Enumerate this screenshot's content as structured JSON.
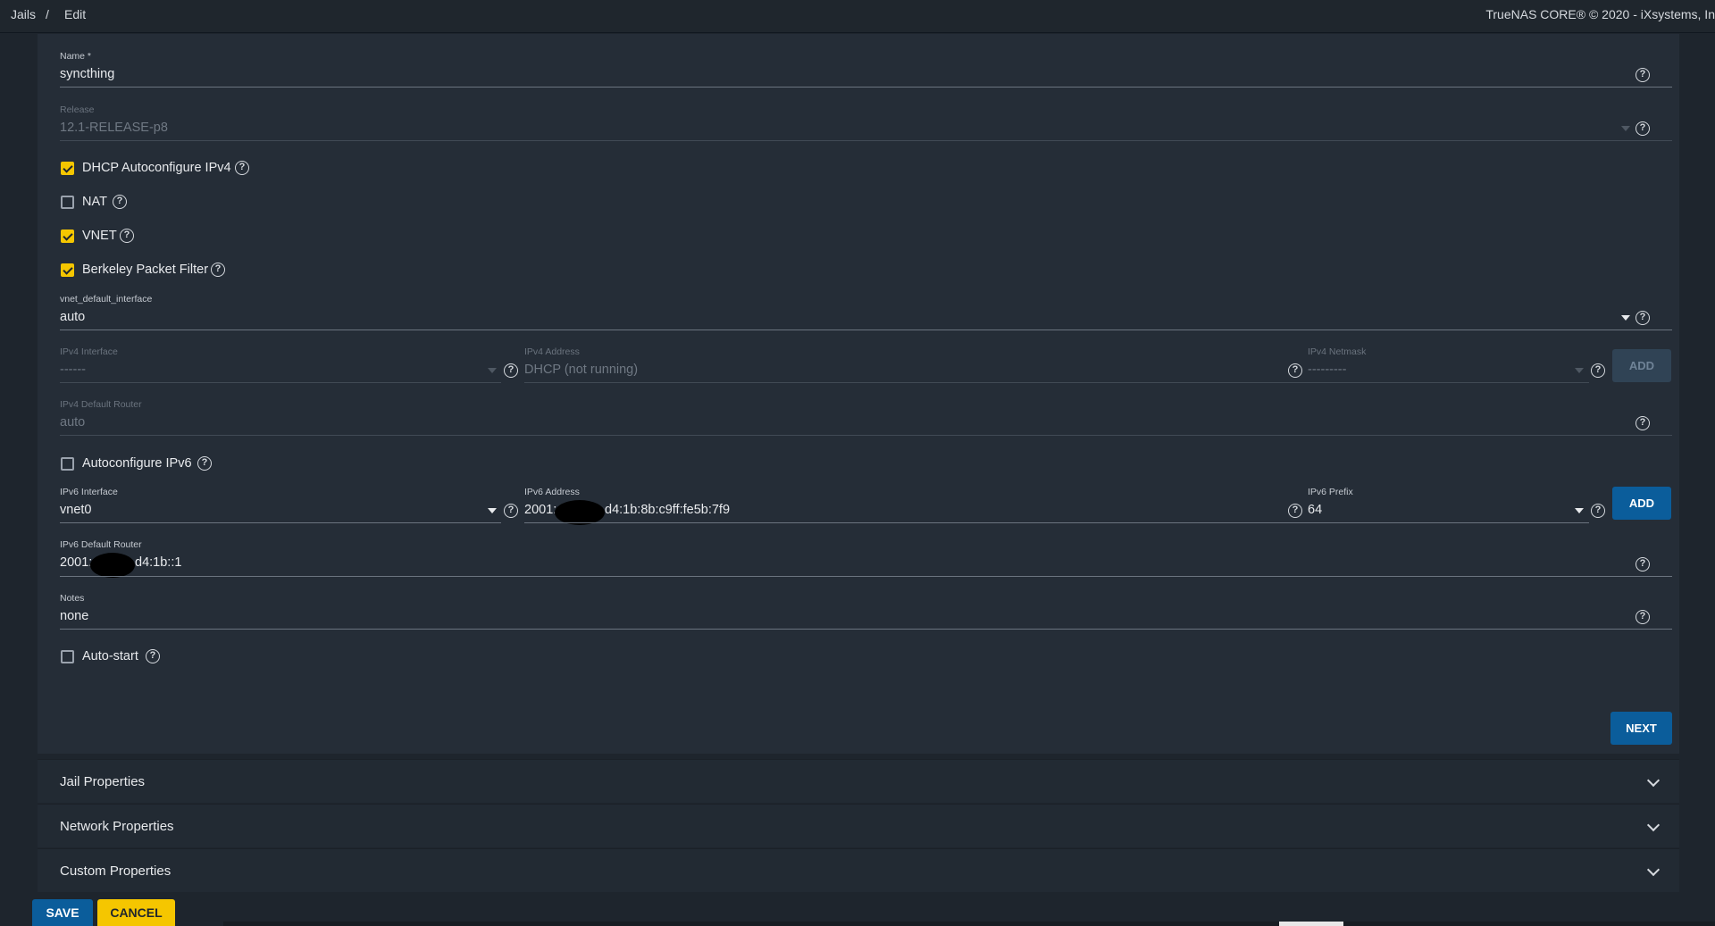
{
  "breadcrumb": {
    "item1": "Jails",
    "separator": "/",
    "item2": "Edit"
  },
  "copyright": "TrueNAS CORE® © 2020 - iXsystems, In",
  "form": {
    "name": {
      "label": "Name *",
      "value": "syncthing"
    },
    "release": {
      "label": "Release",
      "value": "12.1-RELEASE-p8"
    },
    "dhcp": {
      "label": "DHCP Autoconfigure IPv4",
      "checked": true
    },
    "nat": {
      "label": "NAT",
      "checked": false
    },
    "vnet": {
      "label": "VNET",
      "checked": true
    },
    "bpf": {
      "label": "Berkeley Packet Filter",
      "checked": true
    },
    "vnet_default_interface": {
      "label": "vnet_default_interface",
      "value": "auto"
    },
    "ipv4_interface": {
      "label": "IPv4 Interface",
      "value": "------"
    },
    "ipv4_address": {
      "label": "IPv4 Address",
      "value": "DHCP (not running)"
    },
    "ipv4_netmask": {
      "label": "IPv4 Netmask",
      "value": "---------"
    },
    "ipv4_add": "ADD",
    "ipv4_default_router": {
      "label": "IPv4 Default Router",
      "value": "auto"
    },
    "autoconf_ipv6": {
      "label": "Autoconfigure IPv6",
      "checked": false
    },
    "ipv6_interface": {
      "label": "IPv6 Interface",
      "value": "vnet0"
    },
    "ipv6_address": {
      "label": "IPv6 Address",
      "prefix": "2001:",
      "suffix": "d4:1b:8b:c9ff:fe5b:7f9"
    },
    "ipv6_prefix": {
      "label": "IPv6 Prefix",
      "value": "64"
    },
    "ipv6_add": "ADD",
    "ipv6_default_router": {
      "label": "IPv6 Default Router",
      "prefix": "2001:",
      "suffix": "d4:1b::1"
    },
    "notes": {
      "label": "Notes",
      "value": "none"
    },
    "autostart": {
      "label": "Auto-start",
      "checked": false
    },
    "next": "NEXT"
  },
  "sections": [
    "Jail Properties",
    "Network Properties",
    "Custom Properties"
  ],
  "actions": {
    "save": "SAVE",
    "cancel": "CANCEL"
  },
  "icons": {
    "help": "help-circle-icon",
    "dropdown": "caret-down-icon",
    "expand": "chevron-down-icon",
    "check": "checkmark-icon"
  },
  "colors": {
    "accent": "#f5c600",
    "primary": "#0b5d9b",
    "background": "#1e252d",
    "card": "#252d37"
  }
}
